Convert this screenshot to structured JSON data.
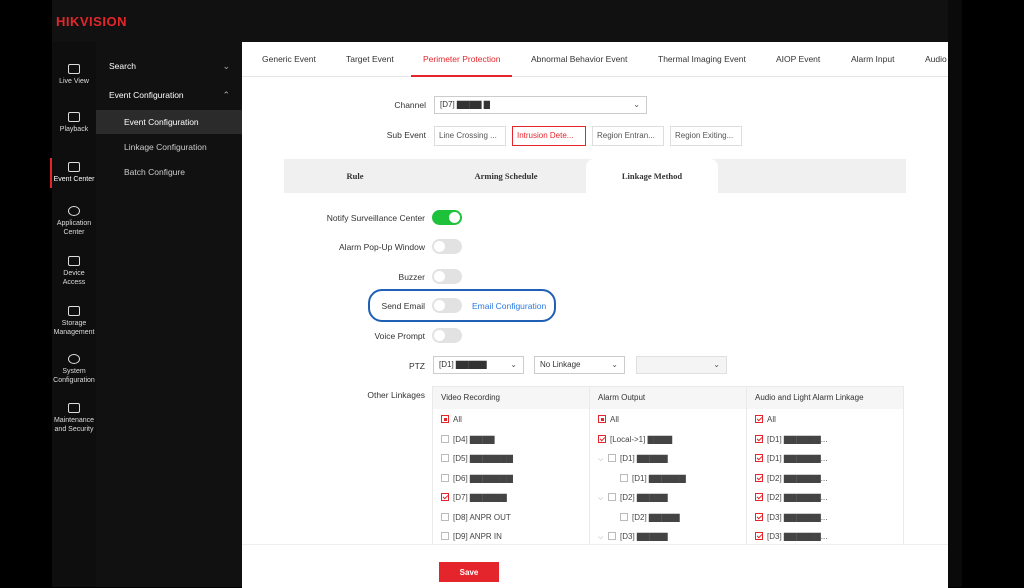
{
  "brand": "HIKVISION",
  "rail": [
    {
      "label": "Live View",
      "icon": "monitor-icon"
    },
    {
      "label": "Playback",
      "icon": "play-icon"
    },
    {
      "label": "Event Center",
      "icon": "event-icon"
    },
    {
      "label": "Application Center",
      "icon": "app-icon"
    },
    {
      "label": "Device Access",
      "icon": "device-icon"
    },
    {
      "label": "Storage Management",
      "icon": "storage-icon"
    },
    {
      "label": "System Configuration",
      "icon": "gear-icon"
    },
    {
      "label": "Maintenance and Security",
      "icon": "shield-icon"
    }
  ],
  "subnav": {
    "search": "Search",
    "event_config": "Event Configuration",
    "items": [
      "Event Configuration",
      "Linkage Configuration",
      "Batch Configure"
    ]
  },
  "tabs": [
    "Generic Event",
    "Target Event",
    "Perimeter Protection",
    "Abnormal Behavior Event",
    "Thermal Imaging Event",
    "AIOP Event",
    "Alarm Input",
    "Audio"
  ],
  "form": {
    "channel_label": "Channel",
    "channel_value": "[D7] ▇▇▇▇ ▇",
    "subevent_label": "Sub Event",
    "subevents": [
      "Line Crossing ...",
      "Intrusion Dete...",
      "Region Entran...",
      "Region Exiting..."
    ]
  },
  "inner_tabs": [
    "Rule",
    "Arming Schedule",
    "Linkage Method"
  ],
  "linkage": {
    "notify": "Notify Surveillance Center",
    "popup": "Alarm Pop-Up Window",
    "buzzer": "Buzzer",
    "email": "Send Email",
    "email_link": "Email Configuration",
    "voice": "Voice Prompt",
    "ptz": "PTZ",
    "ptz_channel": "[D1] ▇▇▇▇▇",
    "ptz_link": "No Linkage",
    "other": "Other Linkages"
  },
  "grid": {
    "video": {
      "title": "Video Recording",
      "rows": [
        {
          "label": "All",
          "state": "partial"
        },
        {
          "label": "[D4] ▇▇▇▇",
          "state": "off"
        },
        {
          "label": "[D5] ▇▇▇▇▇▇▇",
          "state": "off"
        },
        {
          "label": "[D6] ▇▇▇▇▇▇▇",
          "state": "off"
        },
        {
          "label": "[D7] ▇▇▇▇▇▇",
          "state": "on"
        },
        {
          "label": "[D8] ANPR OUT",
          "state": "off"
        },
        {
          "label": "[D9] ANPR IN",
          "state": "off"
        }
      ]
    },
    "alarm": {
      "title": "Alarm Output",
      "rows": [
        {
          "label": "All",
          "state": "partial",
          "indent": 0,
          "tree": false
        },
        {
          "label": "[Local->1] ▇▇▇▇",
          "state": "on",
          "indent": 0,
          "tree": false
        },
        {
          "label": "[D1] ▇▇▇▇▇",
          "state": "off",
          "indent": 0,
          "tree": true
        },
        {
          "label": "[D1] ▇▇▇▇▇▇",
          "state": "off",
          "indent": 1,
          "tree": false
        },
        {
          "label": "[D2] ▇▇▇▇▇",
          "state": "off",
          "indent": 0,
          "tree": true
        },
        {
          "label": "[D2] ▇▇▇▇▇",
          "state": "off",
          "indent": 1,
          "tree": false
        },
        {
          "label": "[D3] ▇▇▇▇▇",
          "state": "off",
          "indent": 0,
          "tree": true
        }
      ]
    },
    "audio": {
      "title": "Audio and Light Alarm Linkage",
      "rows": [
        {
          "label": "All",
          "state": "on"
        },
        {
          "label": "[D1] ▇▇▇▇▇▇...",
          "state": "on"
        },
        {
          "label": "[D1] ▇▇▇▇▇▇...",
          "state": "on"
        },
        {
          "label": "[D2] ▇▇▇▇▇▇...",
          "state": "on"
        },
        {
          "label": "[D2] ▇▇▇▇▇▇...",
          "state": "on"
        },
        {
          "label": "[D3] ▇▇▇▇▇▇...",
          "state": "on"
        },
        {
          "label": "[D3] ▇▇▇▇▇▇...",
          "state": "on"
        }
      ]
    }
  },
  "save_label": "Save",
  "colors": {
    "accent": "#e4262c",
    "toggle_on": "#1ec13a",
    "link": "#2a7ae2",
    "highlight_ring": "#1f5fb5"
  }
}
